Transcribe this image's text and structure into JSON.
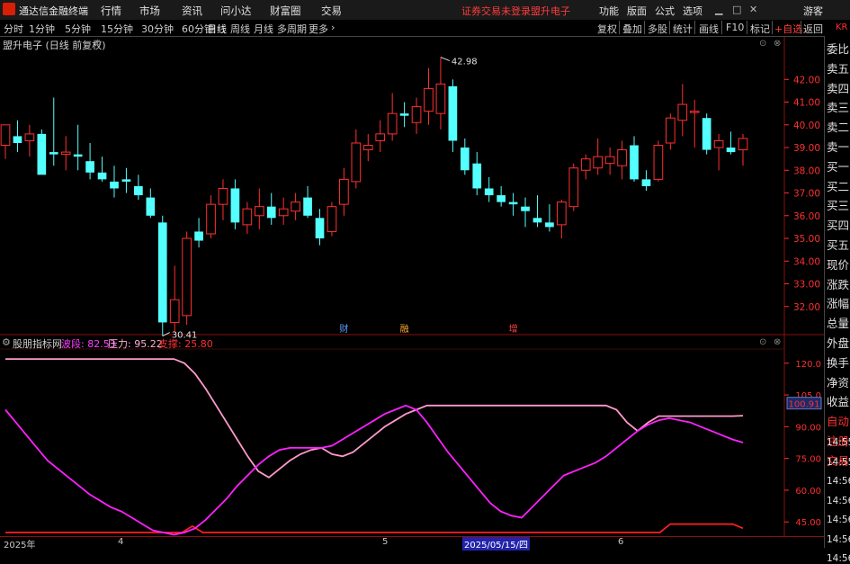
{
  "app": {
    "title": "通达信金融终端",
    "menu": [
      "行情",
      "市场",
      "资讯",
      "问小达",
      "财富圈",
      "交易"
    ],
    "warning": "证券交易未登录",
    "stock_title": "盟升电子",
    "right_menu": [
      "功能",
      "版面",
      "公式",
      "选项"
    ],
    "user": "游客",
    "colors": {
      "up": "#ff3030",
      "down": "#54ffff",
      "accent": "#d81e06"
    }
  },
  "period_bar": {
    "periods": [
      "分时",
      "1分钟",
      "5分钟",
      "15分钟",
      "30分钟",
      "60分钟",
      "日线",
      "周线",
      "月线",
      "多周期",
      "更多"
    ],
    "active": "日线",
    "tools": [
      "复权",
      "叠加",
      "多股",
      "统计",
      "画线",
      "F10",
      "标记",
      "+自选",
      "返回"
    ]
  },
  "chart_header": {
    "text": "盟升电子 (日线 前复权)"
  },
  "right_panel": {
    "kr_label": "KR",
    "items": [
      "委比",
      "卖五",
      "卖四",
      "卖三",
      "卖二",
      "卖一",
      "买一",
      "买二",
      "买三",
      "买四",
      "买五",
      "现价",
      "涨跌",
      "涨幅",
      "总量",
      "外盘",
      "换手",
      "净资",
      "收益",
      "自动",
      "注册",
      "交易"
    ],
    "times": [
      "14:55",
      "14:55",
      "14:56",
      "14:56",
      "14:56",
      "14:56",
      "14:56"
    ]
  },
  "indicator_header": {
    "name": "股朋指标网",
    "wave_label": "波段: 82.53",
    "pressure_label": "压力: 95.22",
    "support_label": "支撑: 25.80"
  },
  "axis": {
    "dates": [
      "2025年",
      "4",
      "5",
      "2025/05/15/四",
      "6"
    ],
    "selected_date": "2025/05/15/四"
  },
  "chart_data": [
    {
      "type": "candlestick",
      "title": "盟升电子 (日线 前复权)",
      "price_ticks": [
        "42.00",
        "41.00",
        "40.00",
        "39.00",
        "38.00",
        "37.00",
        "36.00",
        "35.00",
        "34.00",
        "33.00",
        "32.00"
      ],
      "ylim": [
        31.0,
        43.2
      ],
      "annotations": {
        "high": "42.98",
        "low": "30.41"
      },
      "events": [
        "财",
        "融",
        "增"
      ],
      "candles": [
        {
          "o": 39.1,
          "h": 40.0,
          "l": 38.5,
          "c": 40.0
        },
        {
          "o": 39.5,
          "h": 40.2,
          "l": 38.8,
          "c": 39.2
        },
        {
          "o": 39.3,
          "h": 40.0,
          "l": 38.6,
          "c": 39.6
        },
        {
          "o": 39.6,
          "h": 39.8,
          "l": 38.0,
          "c": 37.8
        },
        {
          "o": 38.8,
          "h": 41.2,
          "l": 38.2,
          "c": 38.7
        },
        {
          "o": 38.7,
          "h": 39.5,
          "l": 38.0,
          "c": 38.8
        },
        {
          "o": 38.7,
          "h": 40.0,
          "l": 38.0,
          "c": 38.6
        },
        {
          "o": 38.4,
          "h": 39.2,
          "l": 37.6,
          "c": 37.9
        },
        {
          "o": 37.9,
          "h": 38.6,
          "l": 37.5,
          "c": 37.6
        },
        {
          "o": 37.5,
          "h": 38.2,
          "l": 36.8,
          "c": 37.2
        },
        {
          "o": 37.6,
          "h": 38.1,
          "l": 37.0,
          "c": 37.5
        },
        {
          "o": 37.3,
          "h": 37.8,
          "l": 36.7,
          "c": 36.9
        },
        {
          "o": 36.8,
          "h": 37.2,
          "l": 35.9,
          "c": 36.0
        },
        {
          "o": 35.7,
          "h": 36.0,
          "l": 30.7,
          "c": 31.3
        },
        {
          "o": 31.3,
          "h": 33.8,
          "l": 30.9,
          "c": 32.3
        },
        {
          "o": 31.6,
          "h": 35.3,
          "l": 31.2,
          "c": 35.0
        },
        {
          "o": 35.3,
          "h": 35.9,
          "l": 34.6,
          "c": 34.9
        },
        {
          "o": 35.2,
          "h": 36.9,
          "l": 35.0,
          "c": 36.5
        },
        {
          "o": 36.5,
          "h": 37.6,
          "l": 35.8,
          "c": 37.2
        },
        {
          "o": 37.2,
          "h": 37.6,
          "l": 35.4,
          "c": 35.7
        },
        {
          "o": 35.6,
          "h": 36.6,
          "l": 35.2,
          "c": 36.3
        },
        {
          "o": 36.0,
          "h": 37.2,
          "l": 35.4,
          "c": 36.4
        },
        {
          "o": 36.4,
          "h": 37.0,
          "l": 35.6,
          "c": 35.9
        },
        {
          "o": 36.0,
          "h": 36.8,
          "l": 35.6,
          "c": 36.3
        },
        {
          "o": 36.2,
          "h": 37.0,
          "l": 35.8,
          "c": 36.6
        },
        {
          "o": 36.8,
          "h": 37.3,
          "l": 35.9,
          "c": 36.0
        },
        {
          "o": 35.9,
          "h": 36.3,
          "l": 34.7,
          "c": 35.0
        },
        {
          "o": 35.3,
          "h": 36.6,
          "l": 35.1,
          "c": 36.4
        },
        {
          "o": 36.5,
          "h": 38.1,
          "l": 36.0,
          "c": 37.6
        },
        {
          "o": 37.5,
          "h": 39.8,
          "l": 37.2,
          "c": 39.2
        },
        {
          "o": 38.9,
          "h": 39.6,
          "l": 38.4,
          "c": 39.1
        },
        {
          "o": 39.3,
          "h": 40.2,
          "l": 38.8,
          "c": 39.6
        },
        {
          "o": 39.6,
          "h": 41.4,
          "l": 39.3,
          "c": 40.5
        },
        {
          "o": 40.5,
          "h": 41.0,
          "l": 39.9,
          "c": 40.4
        },
        {
          "o": 40.1,
          "h": 41.2,
          "l": 39.6,
          "c": 40.8
        },
        {
          "o": 40.6,
          "h": 42.5,
          "l": 40.0,
          "c": 41.6
        },
        {
          "o": 40.5,
          "h": 42.98,
          "l": 39.8,
          "c": 41.8
        },
        {
          "o": 41.7,
          "h": 42.0,
          "l": 38.8,
          "c": 39.3
        },
        {
          "o": 39.0,
          "h": 39.4,
          "l": 37.8,
          "c": 38.0
        },
        {
          "o": 38.3,
          "h": 38.8,
          "l": 36.9,
          "c": 37.2
        },
        {
          "o": 37.2,
          "h": 37.7,
          "l": 36.6,
          "c": 36.9
        },
        {
          "o": 36.9,
          "h": 37.3,
          "l": 36.4,
          "c": 36.6
        },
        {
          "o": 36.6,
          "h": 37.0,
          "l": 36.0,
          "c": 36.5
        },
        {
          "o": 36.4,
          "h": 36.8,
          "l": 35.5,
          "c": 36.2
        },
        {
          "o": 35.9,
          "h": 36.9,
          "l": 35.5,
          "c": 35.7
        },
        {
          "o": 35.7,
          "h": 36.5,
          "l": 35.3,
          "c": 35.5
        },
        {
          "o": 35.6,
          "h": 36.7,
          "l": 35.0,
          "c": 36.6
        },
        {
          "o": 36.4,
          "h": 38.3,
          "l": 36.2,
          "c": 38.1
        },
        {
          "o": 38.0,
          "h": 38.7,
          "l": 37.6,
          "c": 38.5
        },
        {
          "o": 38.1,
          "h": 39.4,
          "l": 37.8,
          "c": 38.6
        },
        {
          "o": 38.3,
          "h": 39.0,
          "l": 37.8,
          "c": 38.6
        },
        {
          "o": 38.2,
          "h": 39.3,
          "l": 37.6,
          "c": 38.9
        },
        {
          "o": 39.1,
          "h": 39.5,
          "l": 37.5,
          "c": 37.6
        },
        {
          "o": 37.6,
          "h": 38.0,
          "l": 37.1,
          "c": 37.3
        },
        {
          "o": 37.6,
          "h": 39.3,
          "l": 37.5,
          "c": 39.1
        },
        {
          "o": 39.2,
          "h": 40.5,
          "l": 38.9,
          "c": 40.3
        },
        {
          "o": 40.2,
          "h": 41.8,
          "l": 39.5,
          "c": 40.9
        },
        {
          "o": 40.6,
          "h": 41.1,
          "l": 39.0,
          "c": 40.6
        },
        {
          "o": 40.3,
          "h": 40.5,
          "l": 38.7,
          "c": 38.9
        },
        {
          "o": 39.0,
          "h": 39.6,
          "l": 38.0,
          "c": 39.3
        },
        {
          "o": 39.0,
          "h": 39.7,
          "l": 38.7,
          "c": 38.8
        },
        {
          "o": 38.9,
          "h": 39.6,
          "l": 38.2,
          "c": 39.4
        }
      ]
    },
    {
      "type": "line",
      "title": "股朋指标网",
      "y_ticks": [
        "120.0",
        "105.0",
        "90.00",
        "75.00",
        "60.00",
        "45.00"
      ],
      "ylim": [
        40,
        125
      ],
      "crosshair_value": "100.91",
      "series": [
        {
          "name": "波段",
          "color": "#ff20ff",
          "values": [
            98,
            92,
            86,
            80,
            74,
            70,
            66,
            62,
            58,
            55,
            52,
            50,
            47,
            44,
            41,
            40,
            39,
            40,
            42,
            46,
            51,
            56,
            62,
            67,
            72,
            76,
            79,
            80,
            80,
            80,
            80,
            81,
            84,
            87,
            90,
            93,
            96,
            98,
            100,
            98,
            92,
            85,
            78,
            72,
            66,
            60,
            54,
            50,
            48,
            47,
            52,
            57,
            62,
            67,
            69,
            71,
            73,
            76,
            80,
            84,
            88,
            91,
            93,
            94,
            93,
            92,
            90,
            88,
            86,
            84,
            82.5
          ]
        },
        {
          "name": "压力",
          "color": "#ff99cc",
          "values": [
            122,
            122,
            122,
            122,
            122,
            122,
            122,
            122,
            122,
            122,
            122,
            122,
            122,
            122,
            122,
            122,
            122,
            120,
            115,
            108,
            100,
            92,
            84,
            76,
            69,
            66,
            70,
            74,
            77,
            79,
            80,
            77,
            76,
            78,
            82,
            86,
            90,
            93,
            96,
            98,
            100,
            100,
            100,
            100,
            100,
            100,
            100,
            100,
            100,
            100,
            100,
            100,
            100,
            100,
            100,
            100,
            100,
            100,
            98,
            92,
            88,
            92,
            95,
            95,
            95,
            95,
            95,
            95,
            95,
            95,
            95.22
          ]
        },
        {
          "name": "支撑",
          "color": "#ff2020",
          "values": [
            40,
            40,
            40,
            40,
            40,
            40,
            40,
            40,
            40,
            40,
            40,
            40,
            40,
            40,
            40,
            40,
            40,
            40,
            43,
            40,
            40,
            40,
            40,
            40,
            40,
            40,
            40,
            40,
            40,
            40,
            40,
            40,
            40,
            40,
            40,
            40,
            40,
            40,
            40,
            40,
            40,
            40,
            40,
            40,
            40,
            40,
            40,
            40,
            40,
            40,
            40,
            40,
            40,
            40,
            40,
            40,
            40,
            40,
            40,
            40,
            40,
            40,
            40,
            40,
            44,
            44,
            44,
            44,
            44,
            44,
            44,
            42
          ]
        }
      ]
    }
  ]
}
